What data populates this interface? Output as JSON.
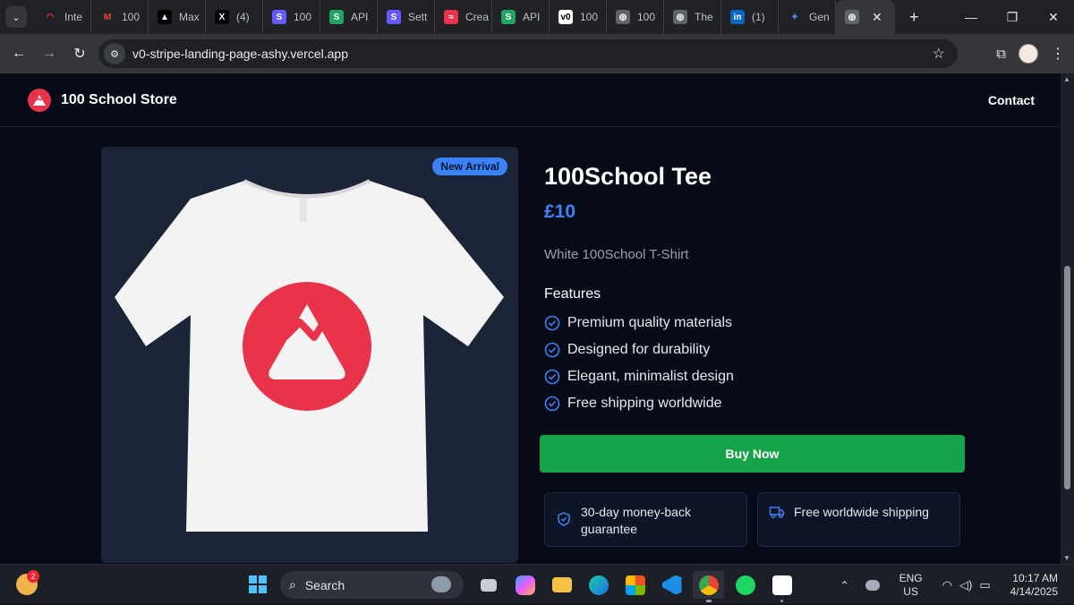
{
  "browser": {
    "tabs": [
      {
        "label": "Inte",
        "fav_color": "#202124",
        "fav_glyph": "◠",
        "fav_fg": "#e33"
      },
      {
        "label": "100",
        "fav_color": "#202124",
        "fav_glyph": "M",
        "fav_fg": "#ea4335"
      },
      {
        "label": "Max",
        "fav_color": "#000000",
        "fav_glyph": "▲",
        "fav_fg": "#ffffff"
      },
      {
        "label": "(4)",
        "fav_color": "#000000",
        "fav_glyph": "X",
        "fav_fg": "#ffffff"
      },
      {
        "label": "100",
        "fav_color": "#635bff",
        "fav_glyph": "S",
        "fav_fg": "#ffffff"
      },
      {
        "label": "API",
        "fav_color": "#1fa463",
        "fav_glyph": "S",
        "fav_fg": "#ffffff"
      },
      {
        "label": "Sett",
        "fav_color": "#635bff",
        "fav_glyph": "S",
        "fav_fg": "#ffffff"
      },
      {
        "label": "Crea",
        "fav_color": "#e8334a",
        "fav_glyph": "≈",
        "fav_fg": "#ffffff"
      },
      {
        "label": "API",
        "fav_color": "#1fa463",
        "fav_glyph": "S",
        "fav_fg": "#ffffff"
      },
      {
        "label": "100",
        "fav_color": "#ffffff",
        "fav_glyph": "v0",
        "fav_fg": "#000000"
      },
      {
        "label": "100",
        "fav_color": "#5f6368",
        "fav_glyph": "◍",
        "fav_fg": "#e8eaed"
      },
      {
        "label": "The",
        "fav_color": "#5f6368",
        "fav_glyph": "◍",
        "fav_fg": "#e8eaed"
      },
      {
        "label": "(1)",
        "fav_color": "#0a66c2",
        "fav_glyph": "in",
        "fav_fg": "#ffffff"
      },
      {
        "label": "Gen",
        "fav_color": "#202124",
        "fav_glyph": "✦",
        "fav_fg": "#4f8df5"
      }
    ],
    "url": "v0-stripe-landing-page-ashy.vercel.app"
  },
  "site": {
    "brand": "100 School Store",
    "nav_contact": "Contact"
  },
  "product": {
    "badge": "New Arrival",
    "title": "100School Tee",
    "price": "£10",
    "description": "White 100School T-Shirt",
    "features_title": "Features",
    "features": [
      "Premium quality materials",
      "Designed for durability",
      "Elegant, minimalist design",
      "Free shipping worldwide"
    ],
    "buy_label": "Buy Now",
    "guarantee": "30-day money-back guarantee",
    "shipping": "Free worldwide shipping"
  },
  "taskbar": {
    "weather_badge": "2",
    "search_label": "Search",
    "lang_top": "ENG",
    "lang_bottom": "US",
    "time": "10:17 AM",
    "date": "4/14/2025"
  },
  "colors": {
    "accent_blue": "#3b82f6",
    "buy_green": "#16a34a",
    "brand_red": "#e8334a"
  }
}
